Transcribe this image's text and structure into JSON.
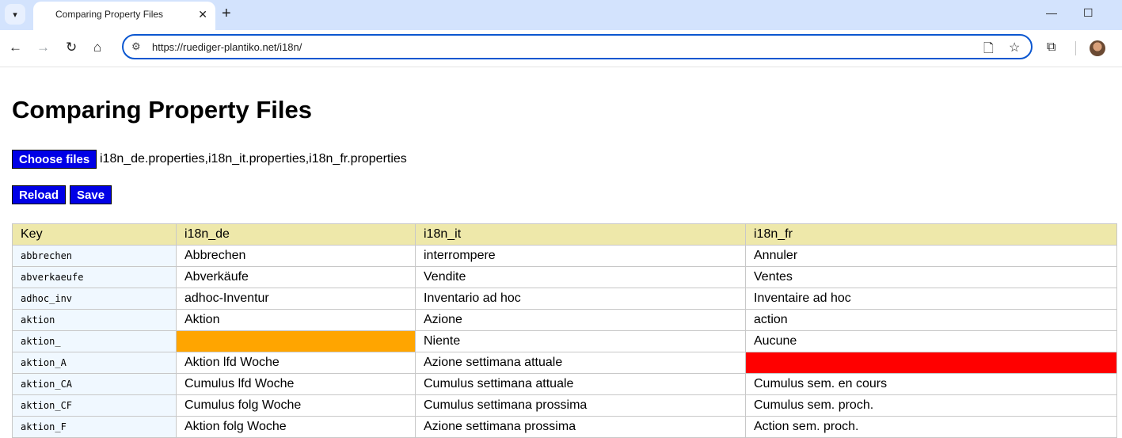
{
  "browser": {
    "tab_title": "Comparing Property Files",
    "url": "https://ruediger-plantiko.net/i18n/"
  },
  "page": {
    "title": "Comparing Property Files",
    "choose_files_label": "Choose files",
    "selected_files": "i18n_de.properties,i18n_it.properties,i18n_fr.properties",
    "reload_label": "Reload",
    "save_label": "Save"
  },
  "table": {
    "headers": [
      "Key",
      "i18n_de",
      "i18n_it",
      "i18n_fr"
    ],
    "rows": [
      {
        "key": "abbrechen",
        "de": "Abbrechen",
        "it": "interrompere",
        "fr": "Annuler"
      },
      {
        "key": "abverkaeufe",
        "de": "Abverkäufe",
        "it": "Vendite",
        "fr": "Ventes"
      },
      {
        "key": "adhoc_inv",
        "de": "adhoc-Inventur",
        "it": "Inventario ad hoc",
        "fr": "Inventaire ad hoc"
      },
      {
        "key": "aktion",
        "de": "Aktion",
        "it": "Azione",
        "fr": "action"
      },
      {
        "key": "aktion_",
        "de": "",
        "it": "Niente",
        "fr": "Aucune"
      },
      {
        "key": "aktion_A",
        "de": "Aktion lfd Woche",
        "it": "Azione settimana attuale",
        "fr": ""
      },
      {
        "key": "aktion_CA",
        "de": "Cumulus lfd Woche",
        "it": "Cumulus settimana attuale",
        "fr": "Cumulus sem. en cours"
      },
      {
        "key": "aktion_CF",
        "de": "Cumulus folg Woche",
        "it": "Cumulus settimana prossima",
        "fr": "Cumulus sem. proch."
      },
      {
        "key": "aktion_F",
        "de": "Aktion folg Woche",
        "it": "Azione settimana prossima",
        "fr": "Action sem. proch."
      }
    ]
  },
  "colors": {
    "button_bg": "#0000e6",
    "header_bg": "#eee8aa",
    "key_bg": "#f0f8ff",
    "missing_de": "#ffa500",
    "missing_fr": "#ff0000"
  }
}
